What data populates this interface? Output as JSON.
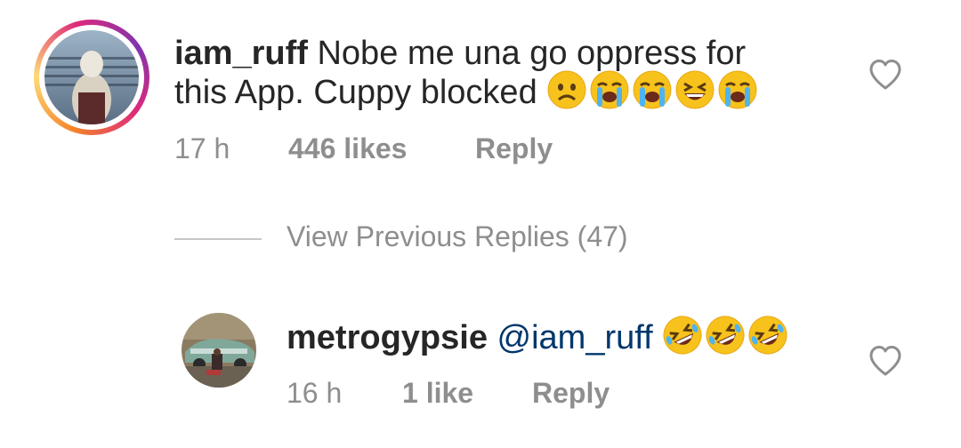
{
  "comment": {
    "username": "iam_ruff",
    "text_line1": "Nobe me una go oppress for",
    "text_line2": "this App. Cuppy blocked",
    "emojis": [
      "worried-face-icon",
      "loudly-crying-face-icon",
      "loudly-crying-face-icon",
      "grinning-squinting-face-icon",
      "loudly-crying-face-icon"
    ],
    "time": "17 h",
    "likes": "446 likes",
    "reply_label": "Reply"
  },
  "view_previous_replies": "View Previous Replies (47)",
  "reply": {
    "username": "metrogypsie",
    "mention": "@iam_ruff",
    "emojis": [
      "rolling-on-floor-laughing-icon",
      "rolling-on-floor-laughing-icon",
      "rolling-on-floor-laughing-icon"
    ],
    "time": "16 h",
    "likes": "1 like",
    "reply_label": "Reply"
  },
  "colors": {
    "text": "#262626",
    "muted": "#8e8e8e",
    "mention": "#00376b",
    "emoji_yellow": "#f7c21c",
    "tear_blue": "#4fb3f0"
  }
}
